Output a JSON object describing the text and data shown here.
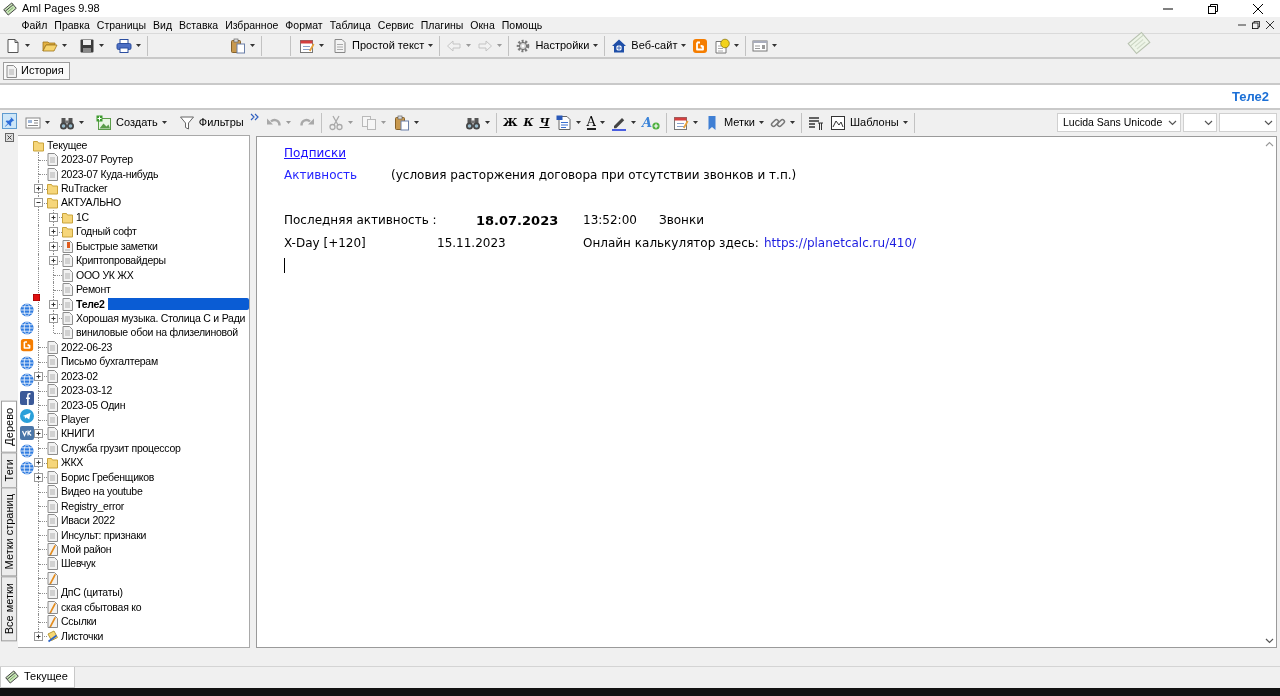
{
  "window": {
    "title": "Aml Pages 9.98"
  },
  "menu": [
    "Файл",
    "Правка",
    "Страницы",
    "Вид",
    "Вставка",
    "Избранное",
    "Формат",
    "Таблица",
    "Сервис",
    "Плагины",
    "Окна",
    "Помощь"
  ],
  "main_toolbar": [
    {
      "dropdown": true,
      "disabled": false
    },
    {
      "dropdown": true,
      "disabled": false
    },
    {
      "dropdown": true,
      "disabled": false
    },
    {
      "dropdown": true,
      "disabled": false
    },
    {
      "dropdown": true,
      "disabled": false
    },
    {
      "dropdown": true,
      "disabled": false
    },
    {
      "label": "Простой текст",
      "dropdown": true,
      "disabled": false
    },
    {
      "dropdown": true,
      "disabled": true
    },
    {
      "dropdown": true,
      "disabled": true
    },
    {
      "label": "Настройки",
      "dropdown": true,
      "disabled": false
    },
    {
      "label": "Веб-сайт",
      "dropdown": true,
      "disabled": false
    },
    {
      "dropdown": false,
      "disabled": false
    },
    {
      "dropdown": true,
      "disabled": false
    },
    {
      "dropdown": true,
      "disabled": false
    }
  ],
  "page_tabs": [
    {
      "label": "История",
      "selected": true
    }
  ],
  "page_title": "Теле2",
  "sidebar": {
    "pin": {
      "pressed": true
    },
    "toolbar": [
      {
        "dropdown": true
      },
      {
        "dropdown": true
      },
      {
        "label": "Создать",
        "dropdown": true
      },
      {
        "label": "Фильтры",
        "dropdown": false
      }
    ],
    "tabs": [
      {
        "label": "Дерево",
        "selected": true
      },
      {
        "label": "Теги",
        "selected": false
      },
      {
        "label": "Метки страниц",
        "selected": false
      },
      {
        "label": "Все метки",
        "selected": false
      }
    ],
    "tree": [
      {
        "label": "Текущее",
        "kind": "folder",
        "selected": false,
        "marked": false,
        "children": [
          {
            "label": "2023-07 Роутер",
            "kind": "page",
            "selected": false,
            "marked": false
          },
          {
            "label": "2023-07 Куда-нибудь",
            "kind": "page",
            "selected": false,
            "marked": false
          },
          {
            "label": "RuTracker",
            "kind": "folder",
            "expanded": false,
            "selected": false,
            "marked": false
          },
          {
            "label": "АКТУАЛЬНО",
            "kind": "folder",
            "expanded": true,
            "selected": false,
            "marked": false,
            "children": [
              {
                "label": "1С",
                "kind": "folder",
                "expanded": false,
                "selected": false,
                "marked": false
              },
              {
                "label": "Годный софт",
                "kind": "folder",
                "expanded": false,
                "selected": false,
                "marked": false
              },
              {
                "label": "Быстрые заметки",
                "kind": "quick",
                "expanded": false,
                "selected": false,
                "marked": false
              },
              {
                "label": "Криптопровайдеры",
                "kind": "page",
                "expanded": false,
                "selected": false,
                "marked": false
              },
              {
                "label": "ООО УК ЖХ",
                "kind": "page",
                "selected": false,
                "marked": false
              },
              {
                "label": "Ремонт",
                "kind": "page",
                "selected": false,
                "marked": false
              },
              {
                "label": "Теле2",
                "kind": "page",
                "expanded": false,
                "selected": true,
                "marked": true
              },
              {
                "label": "Хорошая музыка. Столица С и Ради",
                "kind": "page",
                "expanded": false,
                "selected": false,
                "marked": false
              },
              {
                "label": "виниловые обои на флизелиновой",
                "kind": "page",
                "selected": false,
                "marked": false
              }
            ]
          },
          {
            "label": "2022-06-23",
            "kind": "page",
            "selected": false,
            "marked": false
          },
          {
            "label": "Письмо бухгалтерам",
            "kind": "page",
            "selected": false,
            "marked": false
          },
          {
            "label": "2023-02",
            "kind": "page",
            "expanded": false,
            "selected": false,
            "marked": false
          },
          {
            "label": "2023-03-12",
            "kind": "page",
            "selected": false,
            "marked": false
          },
          {
            "label": "2023-05 Один",
            "kind": "page",
            "selected": false,
            "marked": false
          },
          {
            "label": "Player",
            "kind": "page",
            "selected": false,
            "marked": false
          },
          {
            "label": "КНИГИ",
            "kind": "page",
            "expanded": false,
            "selected": false,
            "marked": false
          },
          {
            "label": "Служба грузит процессор",
            "kind": "page",
            "selected": false,
            "marked": false
          },
          {
            "label": "ЖКХ",
            "kind": "folder",
            "expanded": false,
            "selected": false,
            "marked": false
          },
          {
            "label": "Борис Гребенщиков",
            "kind": "page",
            "expanded": false,
            "selected": false,
            "marked": false
          },
          {
            "label": "Видео на youtube",
            "kind": "page",
            "selected": false,
            "marked": false
          },
          {
            "label": "Registry_error",
            "kind": "page",
            "selected": false,
            "marked": false
          },
          {
            "label": "Иваси 2022",
            "kind": "page",
            "selected": false,
            "marked": false
          },
          {
            "label": "Инсульт: признаки",
            "kind": "page",
            "selected": false,
            "marked": false
          },
          {
            "label": "Мой район",
            "kind": "pencil",
            "selected": false,
            "marked": false
          },
          {
            "label": "Шевчук",
            "kind": "page",
            "selected": false,
            "marked": false
          },
          {
            "kind": "pencil",
            "selected": false,
            "marked": false
          },
          {
            "label": "ДпС (цитаты)",
            "kind": "page",
            "selected": false,
            "marked": false
          },
          {
            "label": "ская сбытовая ко",
            "kind": "pencil",
            "selected": false,
            "marked": false
          },
          {
            "label": "Ссылки",
            "kind": "pencil",
            "selected": false,
            "marked": false
          },
          {
            "label": "Листочки",
            "kind": "stack",
            "expanded": false,
            "selected": false,
            "marked": false
          }
        ]
      }
    ]
  },
  "editor": {
    "toolbar": [
      {
        "dropdown": true,
        "disabled": true
      },
      {
        "dropdown": false,
        "disabled": true
      },
      {
        "dropdown": true,
        "disabled": true
      },
      {
        "dropdown": true,
        "disabled": true
      },
      {
        "dropdown": true,
        "disabled": false
      },
      {
        "dropdown": true,
        "disabled": false
      },
      {
        "label": "Ж",
        "dropdown": false,
        "disabled": false
      },
      {
        "label": "К",
        "dropdown": false,
        "disabled": false
      },
      {
        "label": "Ч",
        "dropdown": false,
        "disabled": false
      },
      {
        "dropdown": true,
        "disabled": false
      },
      {
        "label": "A",
        "dropdown": true,
        "disabled": false
      },
      {
        "dropdown": true,
        "disabled": false
      },
      {
        "label": "A",
        "dropdown": false,
        "disabled": false
      },
      {
        "dropdown": true,
        "disabled": false
      },
      {
        "label": "Метки",
        "dropdown": true,
        "disabled": false
      },
      {
        "dropdown": true,
        "disabled": false
      },
      {
        "dropdown": false,
        "disabled": false
      },
      {
        "label": "Шаблоны",
        "dropdown": true,
        "disabled": false
      }
    ],
    "font": "Lucida Sans Unicode",
    "document": {
      "subscriptions_link": "Подписки",
      "activity": {
        "link": "Активность",
        "note": "(условия расторжения договора при отсутствии звонков и т.п.)"
      },
      "last_activity": {
        "label": "Последняя активность :",
        "date": "18.07.2023",
        "time": "13:52:00",
        "type": "Звонки"
      },
      "x_day": {
        "label": "X-Day [+120]",
        "date": "15.11.2023",
        "calculator_label": "Онлайн калькулятор здесь:",
        "calculator_link": "https://planetcalc.ru/410/"
      }
    }
  },
  "bottom_tabs": [
    {
      "label": "Текущее",
      "selected": true
    }
  ]
}
